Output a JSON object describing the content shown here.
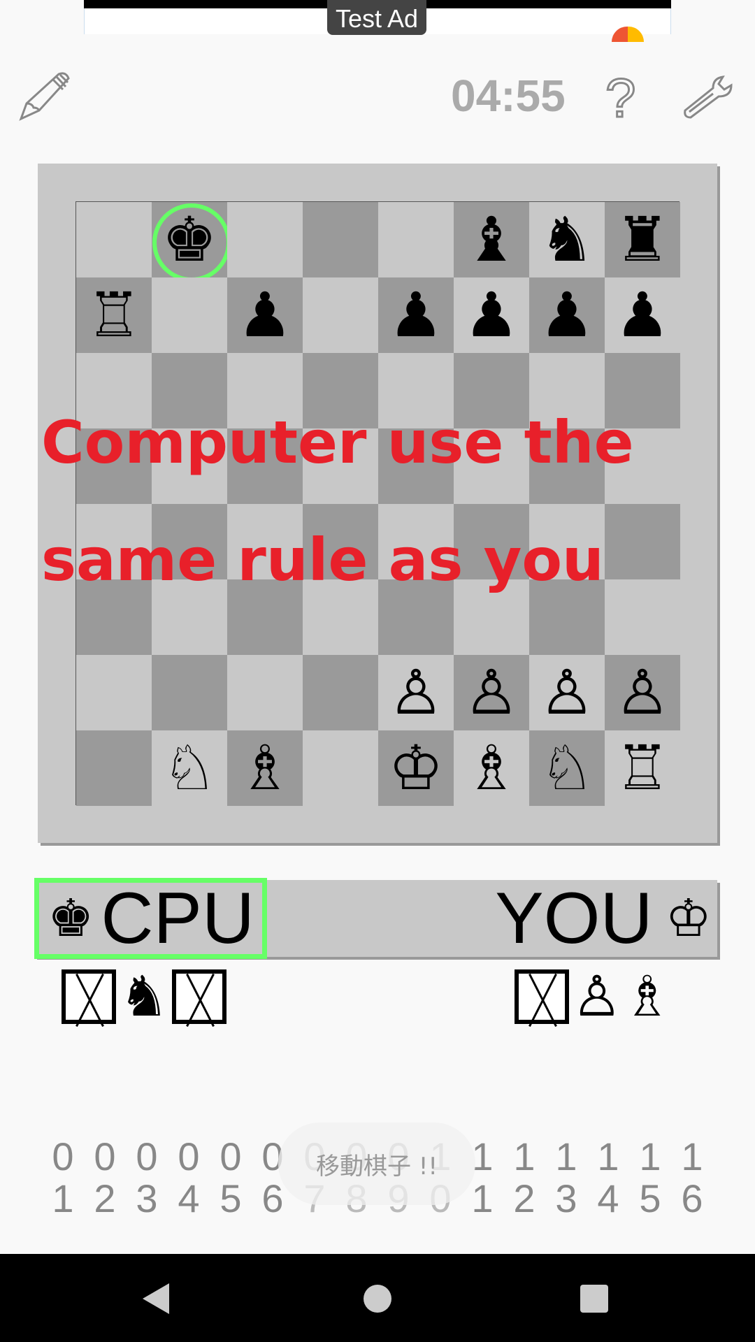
{
  "ad": {
    "label": "Test Ad"
  },
  "toolbar": {
    "timer": "04:55",
    "help": "?",
    "edit_icon": "pencil-icon",
    "settings_icon": "wrench-icon"
  },
  "board": {
    "light_color": "#c8c8c8",
    "dark_color": "#9a9a9a",
    "highlight_color": "#66ff66",
    "selected": "b8",
    "rows": [
      [
        "",
        "♚",
        "",
        "",
        "",
        "♝",
        "♞",
        "♜"
      ],
      [
        "♖",
        "",
        "♟",
        "",
        "♟",
        "♟",
        "♟",
        "♟"
      ],
      [
        "",
        "",
        "",
        "",
        "",
        "",
        "",
        ""
      ],
      [
        "",
        "",
        "",
        "",
        "",
        "",
        "",
        ""
      ],
      [
        "",
        "",
        "",
        "",
        "",
        "",
        "",
        ""
      ],
      [
        "",
        "",
        "",
        "",
        "",
        "",
        "",
        ""
      ],
      [
        "",
        "",
        "",
        "",
        "♙",
        "♙",
        "♙",
        "♙"
      ],
      [
        "",
        "♘",
        "♗",
        "",
        "♔",
        "♗",
        "♘",
        "♖"
      ]
    ]
  },
  "overlay": {
    "line1": "Computer use the",
    "line2": "same rule as you",
    "color": "#e8202a"
  },
  "players": {
    "cpu": {
      "name": "CPU",
      "king": "♚",
      "captured": [
        "☒",
        "♞",
        "☒"
      ]
    },
    "you": {
      "name": "YOU",
      "king": "♔",
      "captured": [
        "☒",
        "♙",
        "♗"
      ]
    }
  },
  "numbers": {
    "top": [
      "0",
      "0",
      "0",
      "0",
      "0",
      "0",
      "0",
      "0",
      "0",
      "1",
      "1",
      "1",
      "1",
      "1",
      "1",
      "1"
    ],
    "bottom": [
      "1",
      "2",
      "3",
      "4",
      "5",
      "6",
      "7",
      "8",
      "9",
      "0",
      "1",
      "2",
      "3",
      "4",
      "5",
      "6"
    ]
  },
  "toast": "移動棋子 !!"
}
